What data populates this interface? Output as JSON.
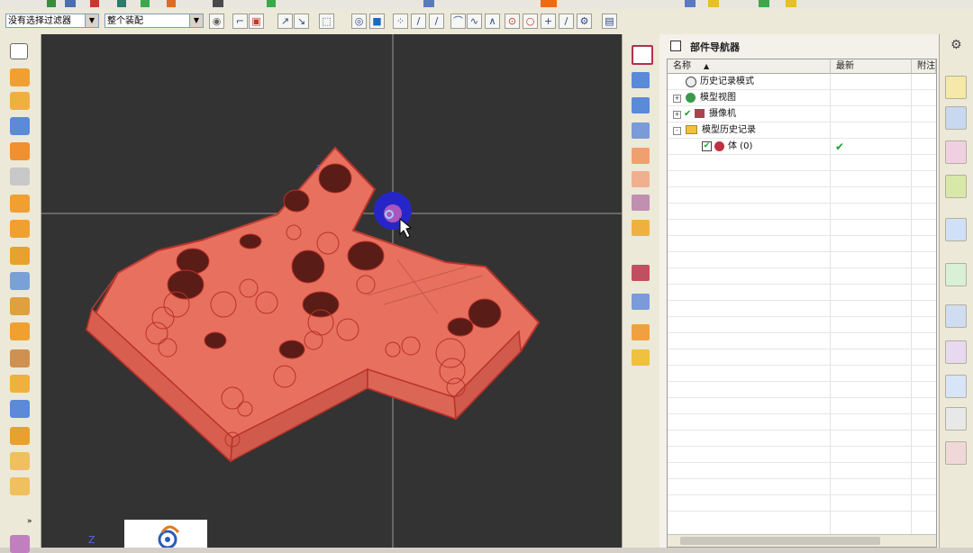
{
  "toolbar": {
    "selection_filter": "没有选择过滤器",
    "assembly_scope": "整个装配"
  },
  "navigator": {
    "title": "部件导航器",
    "columns": {
      "name": "名称",
      "latest": "最新",
      "notes": "附注"
    },
    "rows": [
      {
        "label": "历史记录模式",
        "indent": 0,
        "expand": "",
        "latest": ""
      },
      {
        "label": "模型视图",
        "indent": 0,
        "expand": "+",
        "latest": ""
      },
      {
        "label": "摄像机",
        "indent": 0,
        "expand": "+",
        "latest": ""
      },
      {
        "label": "模型历史记录",
        "indent": 0,
        "expand": "-",
        "latest": ""
      },
      {
        "label": "体 (0)",
        "indent": 1,
        "expand": "",
        "latest": "✔"
      }
    ]
  },
  "colors": {
    "viewport_bg": "#333333",
    "part_fill": "#e8705f",
    "part_edge": "#b8322a",
    "accent_check": "#1e9c2e"
  }
}
